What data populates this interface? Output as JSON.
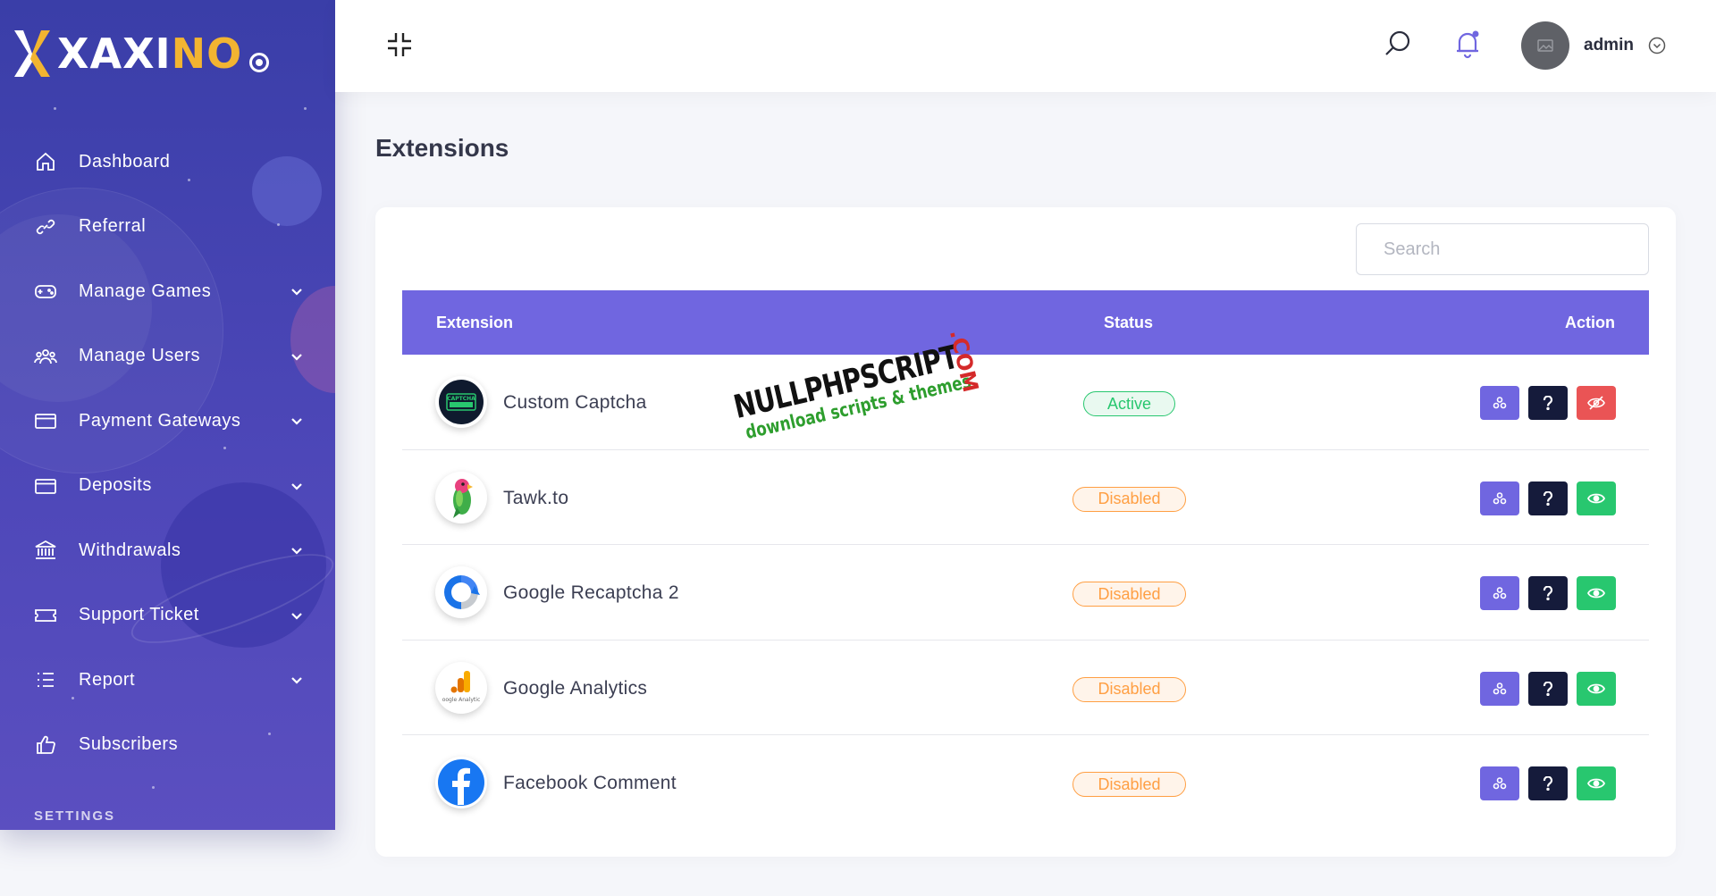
{
  "brand": {
    "name_white": "XAXI",
    "name_gold": "NO",
    "accent": "#7066e0",
    "gold": "#f2b431"
  },
  "sidebar": {
    "items": [
      {
        "label": "Dashboard",
        "icon": "home-icon",
        "has_submenu": false
      },
      {
        "label": "Referral",
        "icon": "link-icon",
        "has_submenu": false
      },
      {
        "label": "Manage Games",
        "icon": "gamepad-icon",
        "has_submenu": true
      },
      {
        "label": "Manage Users",
        "icon": "users-icon",
        "has_submenu": true
      },
      {
        "label": "Payment Gateways",
        "icon": "credit-card-icon",
        "has_submenu": true
      },
      {
        "label": "Deposits",
        "icon": "credit-card-icon",
        "has_submenu": true
      },
      {
        "label": "Withdrawals",
        "icon": "bank-icon",
        "has_submenu": true
      },
      {
        "label": "Support Ticket",
        "icon": "ticket-icon",
        "has_submenu": true
      },
      {
        "label": "Report",
        "icon": "list-icon",
        "has_submenu": true
      },
      {
        "label": "Subscribers",
        "icon": "thumbs-up-icon",
        "has_submenu": false
      }
    ],
    "section_label": "SETTINGS"
  },
  "header": {
    "username": "admin",
    "notification_dot": true
  },
  "page": {
    "title": "Extensions"
  },
  "search": {
    "placeholder": "Search",
    "value": ""
  },
  "table": {
    "columns": [
      "Extension",
      "Status",
      "Action"
    ],
    "rows": [
      {
        "name": "Custom Captcha",
        "status": "Active",
        "logo": "captcha-logo-icon",
        "toggle": "disable"
      },
      {
        "name": "Tawk.to",
        "status": "Disabled",
        "logo": "tawkto-parrot-icon",
        "toggle": "enable"
      },
      {
        "name": "Google Recaptcha 2",
        "status": "Disabled",
        "logo": "recaptcha-logo-icon",
        "toggle": "enable"
      },
      {
        "name": "Google Analytics",
        "status": "Disabled",
        "logo": "google-analytics-logo-icon",
        "toggle": "enable"
      },
      {
        "name": "Facebook Comment",
        "status": "Disabled",
        "logo": "facebook-logo-icon",
        "toggle": "enable"
      }
    ]
  },
  "logo_texts": {
    "captcha": "CAPTCHA",
    "analytics": "oogle Analytic"
  },
  "watermark": {
    "main": "NULLPHPSCRIPT",
    "sub": "download scripts & themes",
    "tld": ".COM"
  },
  "colors": {
    "active": "#28c76f",
    "disabled": "#ff9f43",
    "danger": "#ea5455",
    "dark": "#151b3b"
  }
}
